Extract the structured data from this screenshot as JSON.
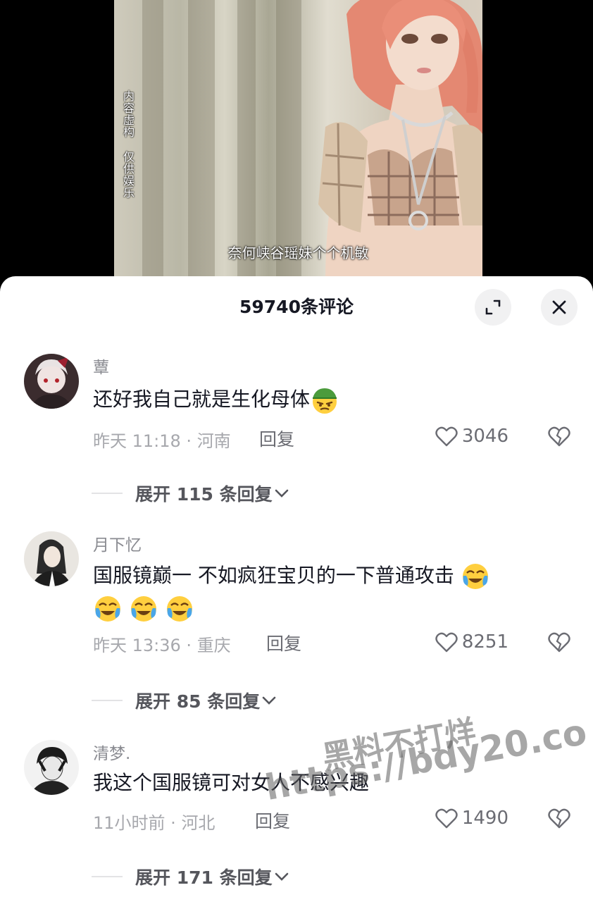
{
  "video": {
    "side_text_1": "内容虚构",
    "side_text_2": "仅供娱乐",
    "subtitle": "奈何峡谷瑶妹个个机敏"
  },
  "sheet": {
    "title": "59740条评论",
    "expand_icon": "expand-icon",
    "close_icon": "close-icon"
  },
  "comments": [
    {
      "username": "蕈",
      "text": "还好我自己就是生化母体",
      "emojis": [
        "scheming-face-emoji"
      ],
      "time": "昨天 11:18",
      "location": "河南",
      "reply_label": "回复",
      "likes": "3046",
      "expand_label": "展开 115 条回复"
    },
    {
      "username": "月下忆",
      "text": "国服镜巅一 不如疯狂宝贝的一下普通攻击",
      "emojis": [
        "crying-laughing-emoji",
        "crying-laughing-emoji",
        "crying-laughing-emoji",
        "crying-laughing-emoji"
      ],
      "time": "昨天 13:36",
      "location": "重庆",
      "reply_label": "回复",
      "likes": "8251",
      "expand_label": "展开 85 条回复"
    },
    {
      "username": "清梦.",
      "text": "我这个国服镜可对女人不感兴趣",
      "emojis": [],
      "time": "11小时前",
      "location": "河北",
      "reply_label": "回复",
      "likes": "1490",
      "expand_label": "展开 171 条回复"
    }
  ],
  "watermark": {
    "line1": "黑料不打烊",
    "line2": "https://bdy20.co"
  },
  "colors": {
    "text_primary": "#161823",
    "text_secondary": "#a7a8ad",
    "button_bg": "#f1f1f2"
  }
}
